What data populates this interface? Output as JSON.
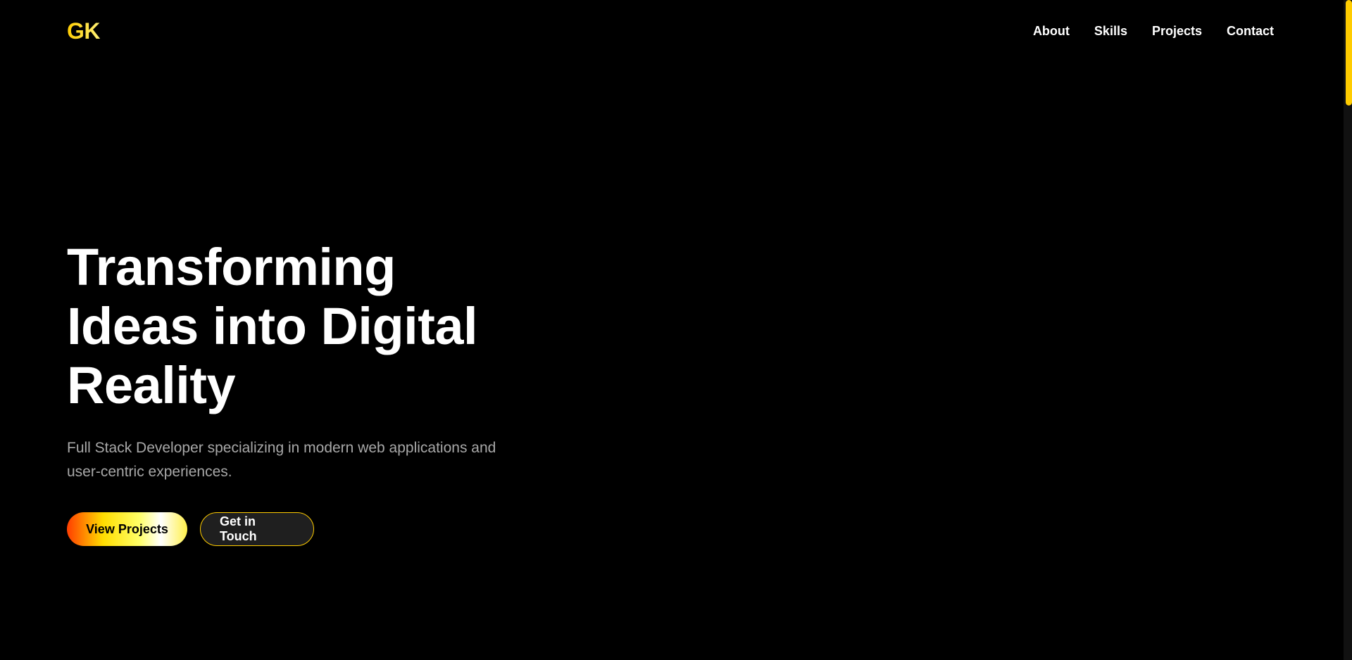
{
  "header": {
    "logo": "GK",
    "nav": [
      {
        "label": "About"
      },
      {
        "label": "Skills"
      },
      {
        "label": "Projects"
      },
      {
        "label": "Contact"
      }
    ]
  },
  "hero": {
    "title_lines": [
      "Transforming",
      "Ideas into Digital",
      "Reality"
    ],
    "subtitle_lines": [
      "Full Stack Developer specializing in modern web applications and",
      "user-centric experiences."
    ],
    "primary_button": "View Projects",
    "secondary_button": "Get in Touch"
  },
  "colors": {
    "background": "#000000",
    "accent": "#ffcc00",
    "text": "#ffffff",
    "muted_text": "#a8a8a8"
  },
  "scrollbar": {
    "position_fraction": 0.0
  }
}
